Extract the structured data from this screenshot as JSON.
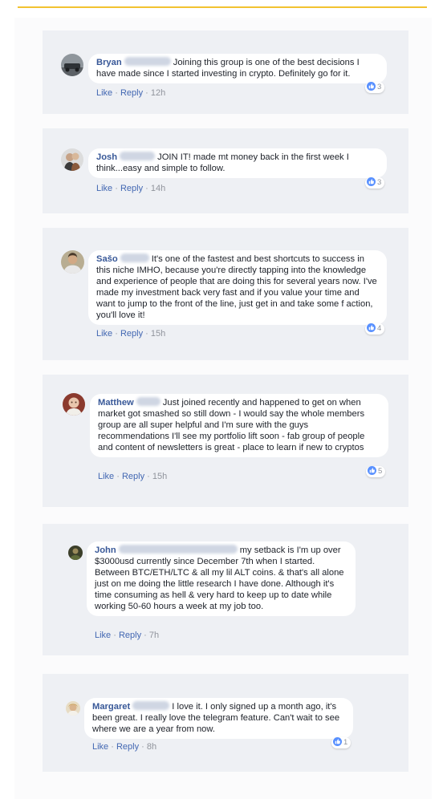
{
  "comments": [
    {
      "name": "Bryan",
      "text": "Joining this group is one of the best decisions I have made since I started investing in crypto. Definitely go for it.",
      "like_label": "Like",
      "reply_label": "Reply",
      "time": "12h",
      "reaction_count": "3"
    },
    {
      "name": "Josh",
      "text": "JOIN IT! made mt money back in the first week I think...easy and simple to follow.",
      "like_label": "Like",
      "reply_label": "Reply",
      "time": "14h",
      "reaction_count": "3"
    },
    {
      "name": "Sašo",
      "text": "It's one of the fastest and best shortcuts to success in this niche IMHO, because you're directly tapping into the knowledge and experience of people that are doing this for several years now. I've made my investment back very fast and if you value your time and want to jump to the front of the line, just get in and take some f action, you'll love it!",
      "like_label": "Like",
      "reply_label": "Reply",
      "time": "15h",
      "reaction_count": "4"
    },
    {
      "name": "Matthew",
      "text": "Just joined recently and happened to get on when market got smashed so still down - I would say the whole members group are all super helpful and I'm sure with the guys recommendations I'll see my portfolio lift soon - fab group of people and content of newsletters is great - place to learn if new to cryptos",
      "like_label": "Like",
      "reply_label": "Reply",
      "time": "15h",
      "reaction_count": "5"
    },
    {
      "name": "John",
      "text": "my setback is I'm up over $3000usd currently since December 7th when I started. Between BTC/ETH/LTC & all my lil ALT coins. & that's all alone just on me doing the little research I have done. Although it's time consuming as hell & very hard to keep up to date while working 50-60 hours a week at my job too.",
      "like_label": "Like",
      "reply_label": "Reply",
      "time": "7h",
      "reaction_count": ""
    },
    {
      "name": "Margaret",
      "text": "I love it. I only signed up a month ago, it's been great. I really love the telegram feature. Can't wait to see where we are a year from now.",
      "like_label": "Like",
      "reply_label": "Reply",
      "time": "8h",
      "reaction_count": "1"
    }
  ],
  "separator": "·",
  "icons": {
    "like_reaction": "thumbs-up-icon"
  },
  "colors": {
    "name": "#385898",
    "link": "#4267b2",
    "reaction": "#5890ff",
    "accent_line": "#f2c230"
  }
}
